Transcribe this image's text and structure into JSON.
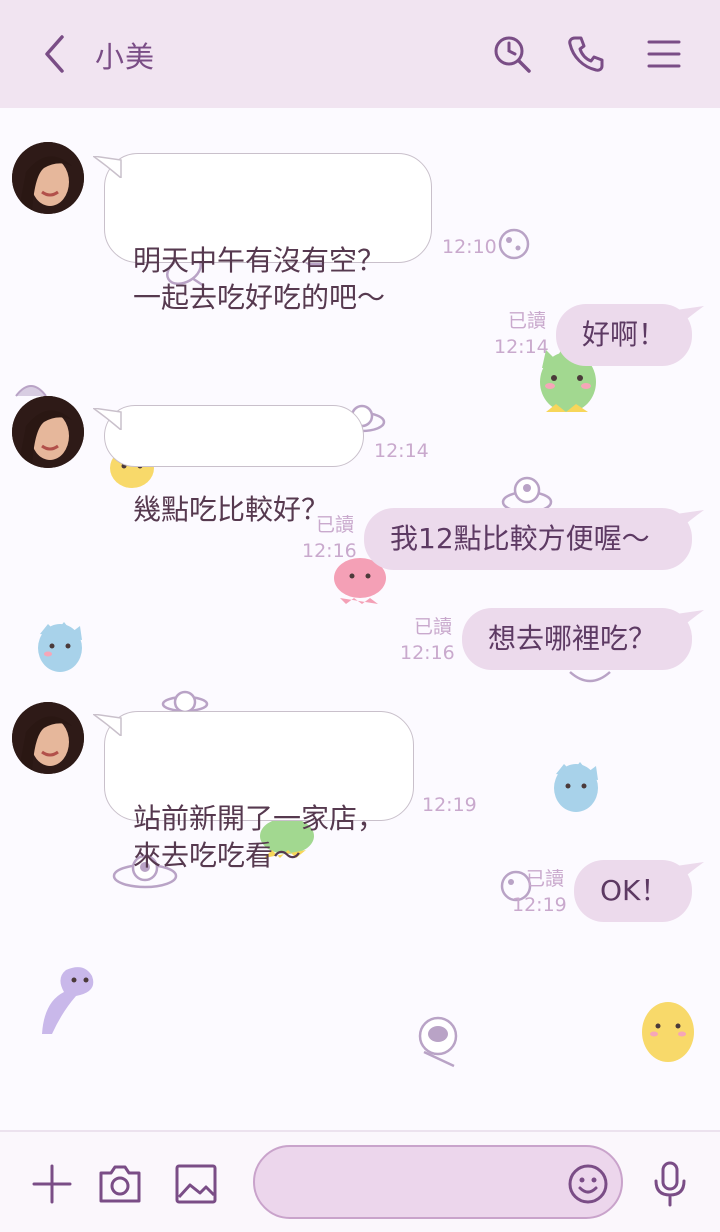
{
  "header": {
    "title": "小美"
  },
  "messages": [
    {
      "id": 1,
      "side": "in",
      "text": "明天中午有沒有空？\n一起去吃好吃的吧～",
      "time": "12:10"
    },
    {
      "id": 2,
      "side": "out",
      "text": "好啊！",
      "read": "已讀",
      "time": "12:14"
    },
    {
      "id": 3,
      "side": "in",
      "text": "幾點吃比較好？",
      "time": "12:14"
    },
    {
      "id": 4,
      "side": "out",
      "text": "我12點比較方便喔～",
      "read": "已讀",
      "time": "12:16"
    },
    {
      "id": 5,
      "side": "out",
      "text": "想去哪裡吃？",
      "read": "已讀",
      "time": "12:16"
    },
    {
      "id": 6,
      "side": "in",
      "text": "站前新開了一家店，\n來去吃吃看～",
      "time": "12:19"
    },
    {
      "id": 7,
      "side": "out",
      "text": "OK！",
      "read": "已讀",
      "time": "12:19"
    }
  ],
  "input": {
    "value": "",
    "placeholder": ""
  },
  "colors": {
    "header_bg": "#f1e4f1",
    "accent": "#7a4d86",
    "out_bubble": "#ecdaec",
    "in_bubble": "#ffffff",
    "meta_text": "#c9a9cd"
  },
  "icons": {
    "back": "chevron-left-icon",
    "search": "search-clock-icon",
    "call": "phone-icon",
    "menu": "hamburger-menu-icon",
    "plus": "plus-icon",
    "camera": "camera-icon",
    "image": "image-icon",
    "emoji": "smiley-icon",
    "mic": "microphone-icon"
  }
}
